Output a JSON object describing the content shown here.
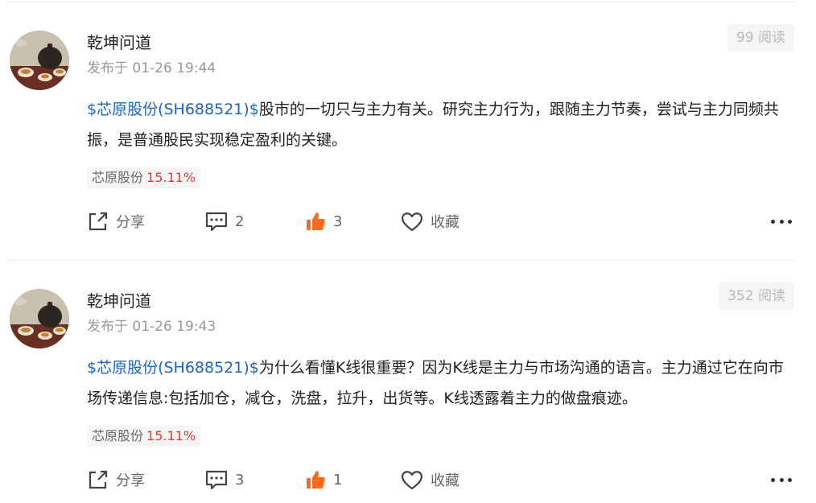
{
  "posts": [
    {
      "author": "乾坤问道",
      "time": "发布于 01-26 19:44",
      "reads": "99 阅读",
      "stock_link": "$芯原股份(SH688521)$",
      "text": "股市的一切只与主力有关。研究主力行为，跟随主力节奏，尝试与主力同频共振，是普通股民实现稳定盈利的关键。",
      "tag_name": "芯原股份",
      "tag_pct": "15.11%",
      "share_label": "分享",
      "comment_count": "2",
      "like_count": "3",
      "fav_label": "收藏"
    },
    {
      "author": "乾坤问道",
      "time": "发布于 01-26 19:43",
      "reads": "352 阅读",
      "stock_link": "$芯原股份(SH688521)$",
      "text": "为什么看懂K线很重要？因为K线是主力与市场沟通的语言。主力通过它在向市场传递信息:包括加仓，减仓，洗盘，拉升，出货等。K线透露着主力的做盘痕迹。",
      "tag_name": "芯原股份",
      "tag_pct": "15.11%",
      "share_label": "分享",
      "comment_count": "3",
      "like_count": "1",
      "fav_label": "收藏"
    }
  ],
  "colors": {
    "link": "#1a66c4",
    "up": "#e53b2c",
    "like": "#ff6a1a"
  },
  "icons": [
    "share-icon",
    "comment-icon",
    "thumbs-up-icon",
    "heart-icon",
    "more-icon"
  ]
}
